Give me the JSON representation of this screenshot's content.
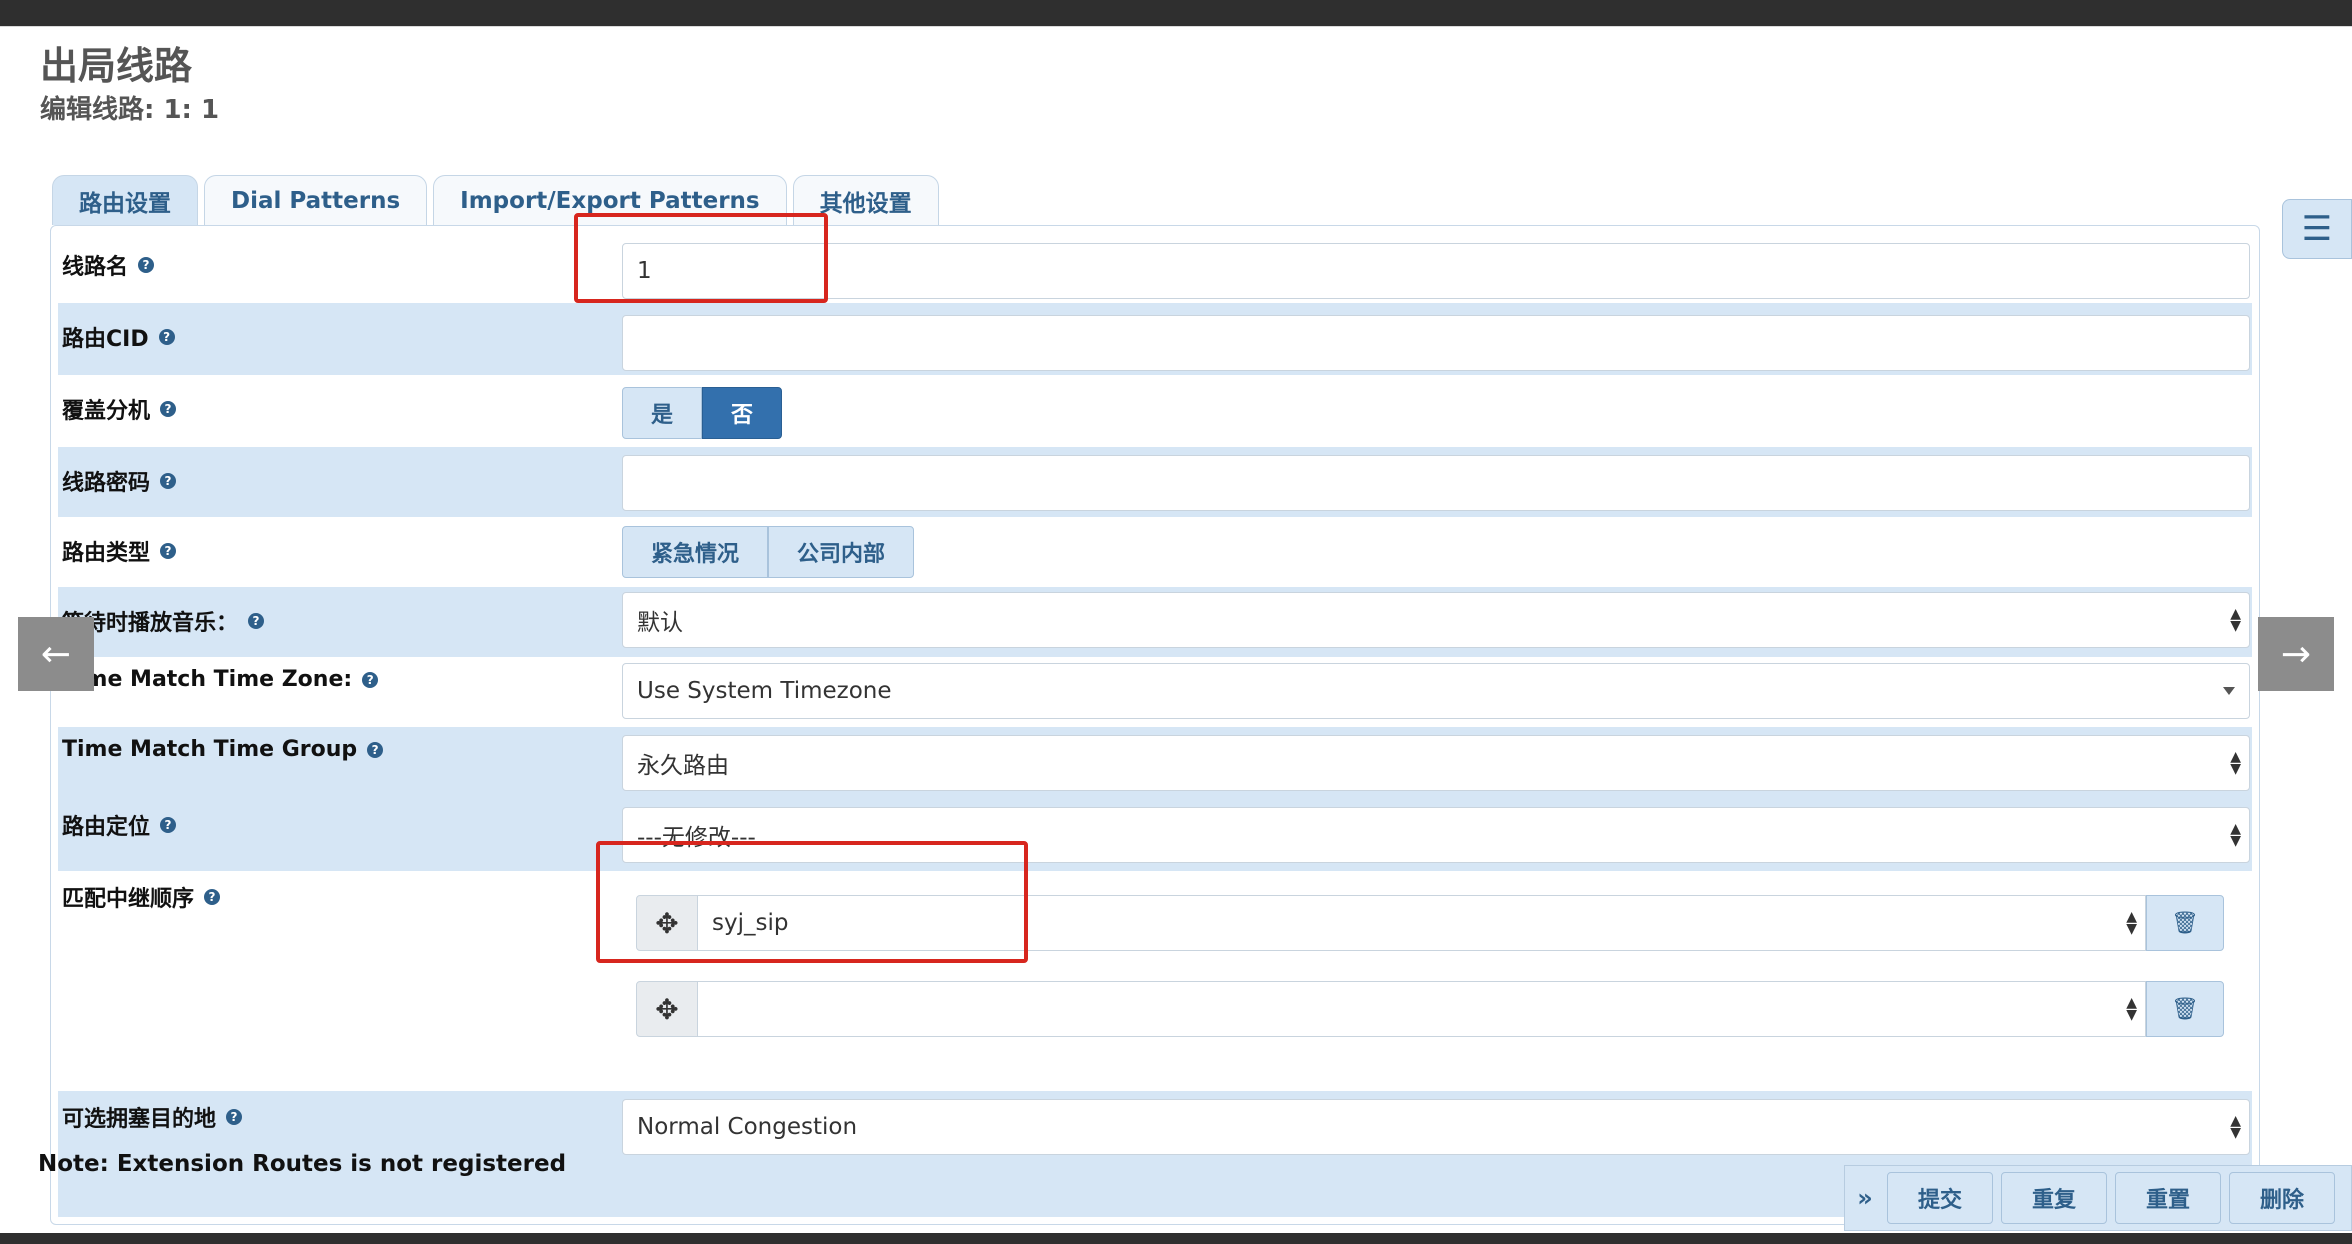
{
  "page": {
    "title": "出局线路",
    "subtitle": "编辑线路: 1: 1"
  },
  "tabs": [
    {
      "label": "路由设置",
      "active": true
    },
    {
      "label": "Dial Patterns",
      "active": false
    },
    {
      "label": "Import/Export Patterns",
      "active": false
    },
    {
      "label": "其他设置",
      "active": false
    }
  ],
  "form": {
    "route_name": {
      "label": "线路名",
      "value": "1"
    },
    "route_cid": {
      "label": "路由CID",
      "value": ""
    },
    "override_extension": {
      "label": "覆盖分机",
      "options": [
        "是",
        "否"
      ],
      "selected": "否"
    },
    "route_password": {
      "label": "线路密码",
      "value": ""
    },
    "route_type": {
      "label": "路由类型",
      "options": [
        "紧急情况",
        "公司内部"
      ]
    },
    "music_on_hold": {
      "label": "等待时播放音乐：",
      "value": "默认"
    },
    "time_zone": {
      "label": "Time Match Time Zone:",
      "value": "Use System Timezone"
    },
    "time_group": {
      "label": "Time Match Time Group",
      "value": "永久路由"
    },
    "route_position": {
      "label": "路由定位",
      "value": "---无修改---"
    },
    "trunk_sequence": {
      "label": "匹配中继顺序",
      "trunks": [
        "syj_sip",
        ""
      ]
    },
    "congestion_destination": {
      "label": "可选拥塞目的地",
      "value": "Normal Congestion"
    }
  },
  "note": "Note: Extension Routes is not registered",
  "actions": {
    "submit": "提交",
    "duplicate": "重复",
    "reset": "重置",
    "delete": "删除"
  },
  "icons": {
    "help": "question-circle-icon",
    "drag": "move-arrows-icon",
    "trash": "trash-icon",
    "list": "list-icon",
    "prev": "arrow-left-icon",
    "next": "arrow-right-icon",
    "expand": "double-chevron-right-icon"
  },
  "colors": {
    "accent": "#2e5f8a",
    "shaded_row": "#d6e6f5",
    "selected_toggle": "#3370ad",
    "highlight": "#d7261e"
  }
}
